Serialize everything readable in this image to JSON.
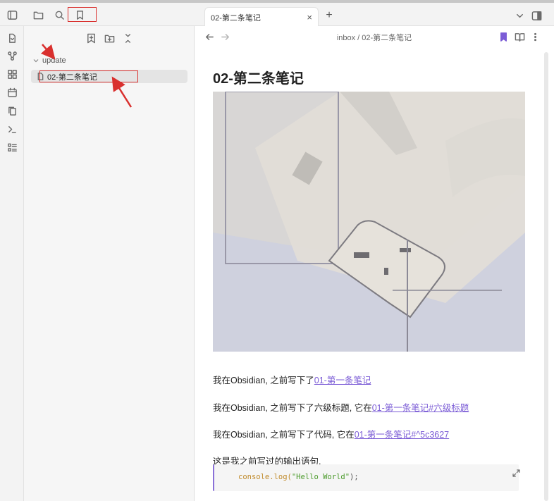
{
  "window": {
    "tab_title": "02-第二条笔记",
    "tab_close": "×",
    "new_tab": "+"
  },
  "breadcrumb": {
    "text": "inbox / 02-第二条笔记"
  },
  "file_tree": {
    "folder_name": "update",
    "file_name": "02-第二条笔记"
  },
  "note": {
    "title": "02-第二条笔记",
    "p1_text": "我在Obsidian, 之前写下了",
    "p1_link": "01-第一条笔记",
    "p2_text": "我在Obsidian, 之前写下了六级标题, 它在",
    "p2_link": "01-第一条笔记#六级标题",
    "p3_text": "我在Obsidian, 之前写下了代码, 它在",
    "p3_link": "01-第一条笔记#^5c3627",
    "p4_text": "这是我之前写过的输出语句,",
    "code_fn": "console.log(",
    "code_str": "\"Hello World\"",
    "code_end": ");"
  },
  "colors": {
    "accent": "#7b5cd6",
    "annotation_red": "#d9302e"
  }
}
